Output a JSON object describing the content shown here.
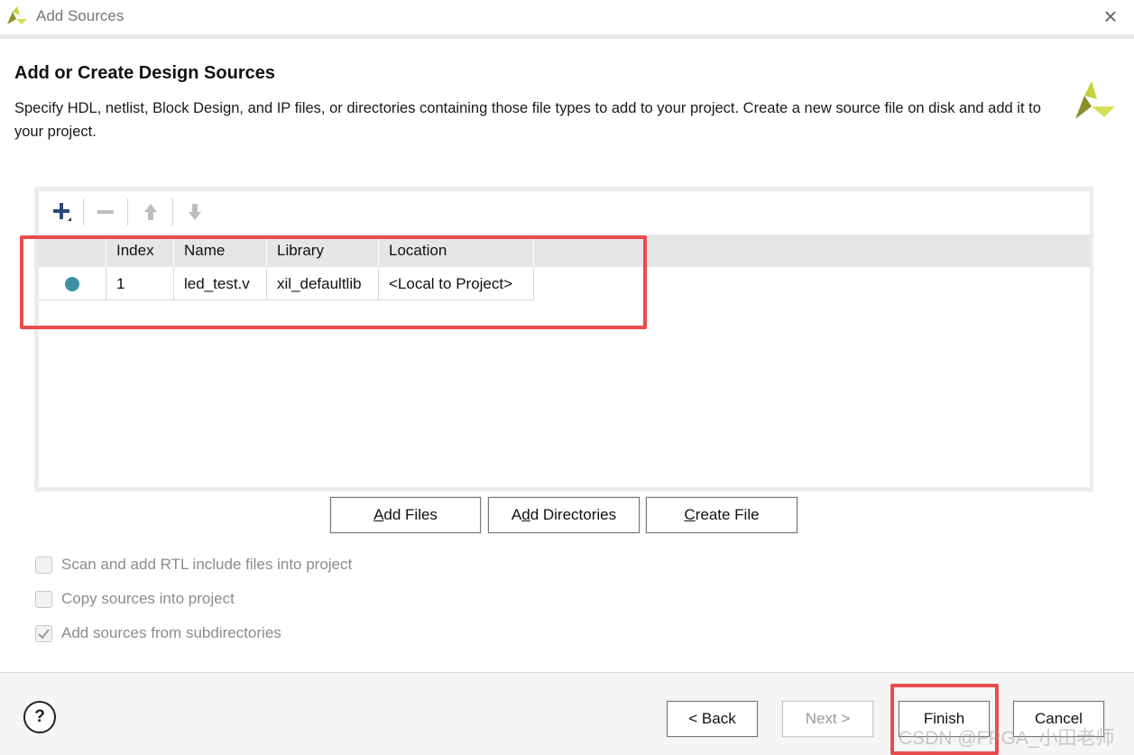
{
  "window": {
    "title": "Add Sources",
    "close_icon": "close-icon"
  },
  "header": {
    "title": "Add or Create Design Sources",
    "description": "Specify HDL, netlist, Block Design, and IP files, or directories containing those file types to add to your project. Create a new source file on disk and add it to your project.",
    "logo_icon": "xilinx-logo-icon"
  },
  "toolbar": {
    "items": [
      "add-icon",
      "remove-icon",
      "move-up-icon",
      "move-down-icon"
    ]
  },
  "table": {
    "columns": [
      "",
      "Index",
      "Name",
      "Library",
      "Location"
    ],
    "rows": [
      {
        "status": "dot",
        "index": "1",
        "name": "led_test.v",
        "library": "xil_defaultlib",
        "location": "<Local to Project>"
      }
    ]
  },
  "actions": {
    "add_files": {
      "label": "Add Files",
      "mnemonic": "A"
    },
    "add_directories": {
      "label": "Add Directories",
      "mnemonic": "d"
    },
    "create_file": {
      "label": "Create File",
      "mnemonic": "C"
    }
  },
  "options": [
    {
      "label": "Scan and add RTL include files into project",
      "checked": false,
      "enabled": false
    },
    {
      "label": "Copy sources into project",
      "checked": false,
      "enabled": false
    },
    {
      "label": "Add sources from subdirectories",
      "checked": true,
      "enabled": false
    }
  ],
  "footer": {
    "help_label": "?",
    "back_label": "< Back",
    "next_label": "Next >",
    "finish_label": "Finish",
    "cancel_label": "Cancel"
  },
  "watermark": "CSDN @FPGA_小田老师",
  "colors": {
    "highlight": "#e84c4c",
    "status_dot": "#3f8fa3",
    "logo_light": "#c8d23a",
    "logo_dark": "#8a8f2a"
  }
}
